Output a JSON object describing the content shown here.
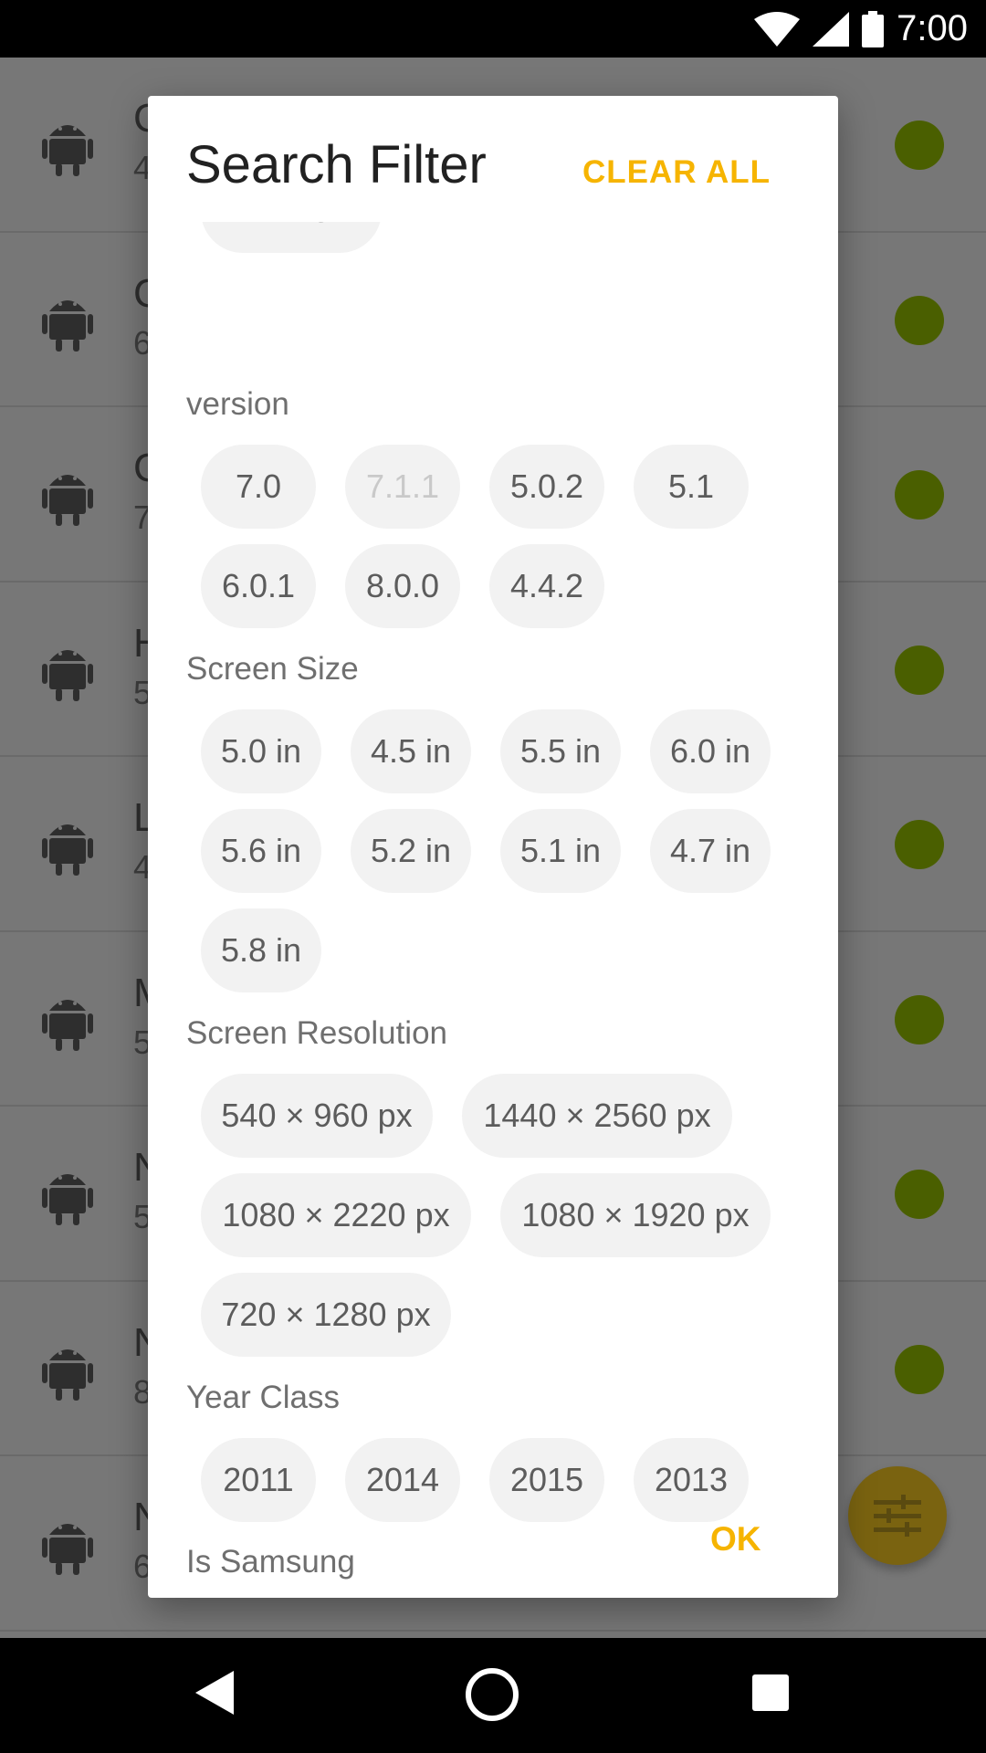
{
  "status_bar": {
    "time": "7:00"
  },
  "background_list": {
    "rows": [
      {
        "title": "G",
        "sub": "4"
      },
      {
        "title": "G",
        "sub": "6"
      },
      {
        "title": "G",
        "sub": "7"
      },
      {
        "title": "H",
        "sub": "5"
      },
      {
        "title": "L",
        "sub": "4"
      },
      {
        "title": "M",
        "sub": "5"
      },
      {
        "title": "N",
        "sub": "5"
      },
      {
        "title": "N",
        "sub": "8"
      },
      {
        "title": "N",
        "sub": "6"
      }
    ]
  },
  "dialog": {
    "title": "Search Filter",
    "clear_all": "CLEAR ALL",
    "ok": "OK",
    "top_partial_chip": "ANDROID",
    "version": {
      "label": "version",
      "chips": [
        "7.0",
        "7.1.1",
        "5.0.2",
        "5.1",
        "6.0.1",
        "8.0.0",
        "4.4.2"
      ],
      "disabled": [
        "7.1.1"
      ]
    },
    "screen_size": {
      "label": "Screen Size",
      "chips": [
        "5.0 in",
        "4.5 in",
        "5.5 in",
        "6.0 in",
        "5.6 in",
        "5.2 in",
        "5.1 in",
        "4.7 in",
        "5.8 in"
      ]
    },
    "screen_resolution": {
      "label": "Screen Resolution",
      "chips": [
        "540 × 960 px",
        "1440 × 2560 px",
        "1080 × 2220 px",
        "1080 × 1920 px",
        "720 × 1280 px"
      ]
    },
    "year_class": {
      "label": "Year Class",
      "chips": [
        "2011",
        "2014",
        "2015",
        "2013"
      ]
    },
    "is_samsung": {
      "label": "Is Samsung"
    }
  },
  "colors": {
    "accent": "#F6B400",
    "chip_bg": "#F2F2F2",
    "status_dot": "#4A5F00",
    "scrim": "#777777"
  },
  "icons": [
    "wifi-icon",
    "signal-icon",
    "battery-icon",
    "android-icon",
    "tune-icon",
    "back-icon",
    "home-icon",
    "recents-icon"
  ]
}
